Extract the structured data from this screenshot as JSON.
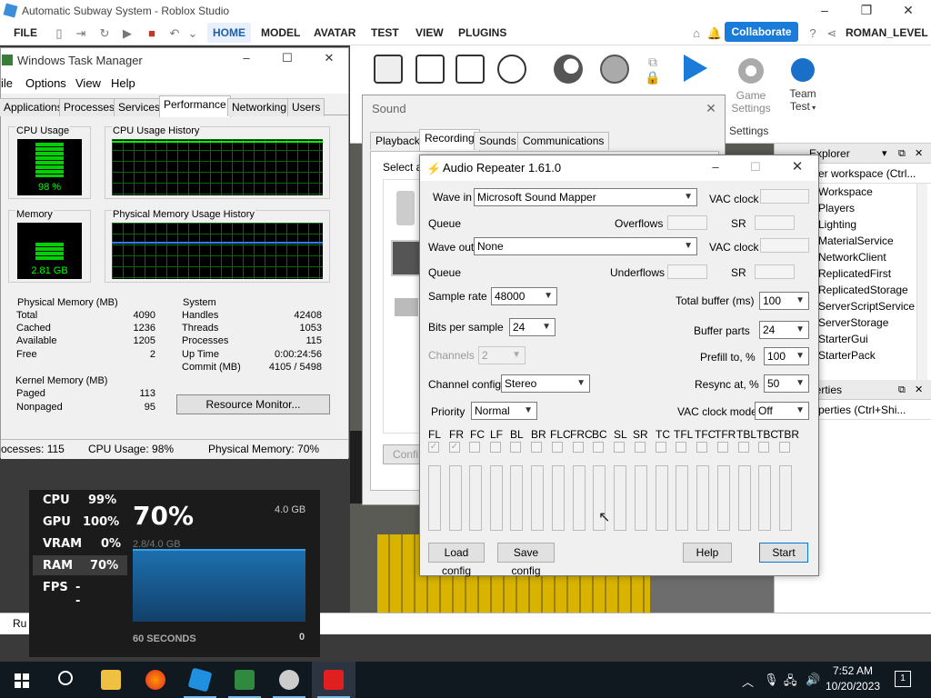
{
  "studio": {
    "title": "Automatic Subway System - Roblox Studio",
    "menu": [
      "FILE",
      "HOME",
      "MODEL",
      "AVATAR",
      "TEST",
      "VIEW",
      "PLUGINS"
    ],
    "collaborate": "Collaborate",
    "user": "ROMAN_LEVEL",
    "ribbon": {
      "game_settings_line1": "Game",
      "game_settings_line2": "Settings",
      "team_test_line1": "Team",
      "team_test_line2": "Test",
      "settings_group": "Settings"
    },
    "explorer": {
      "title": "Explorer",
      "search": "er workspace (Ctrl...",
      "items": [
        "Workspace",
        "Players",
        "Lighting",
        "MaterialService",
        "NetworkClient",
        "ReplicatedFirst",
        "ReplicatedStorage",
        "ServerScriptService",
        "ServerStorage",
        "StarterGui",
        "StarterPack"
      ]
    },
    "properties": {
      "title": "perties",
      "search": "perties (Ctrl+Shi..."
    },
    "bottom_text": "Ru"
  },
  "taskmgr": {
    "title": "Windows Task Manager",
    "menu": [
      "ile",
      "Options",
      "View",
      "Help"
    ],
    "tabs": [
      "Applications",
      "Processes",
      "Services",
      "Performance",
      "Networking",
      "Users"
    ],
    "cpu_usage_label": "CPU Usage",
    "cpu_usage_value": "98 %",
    "cpu_fraction": 0.98,
    "cpu_history_label": "CPU Usage History",
    "memory_label": "Memory",
    "memory_value": "2.81 GB",
    "memory_fraction": 0.51,
    "mem_history_label": "Physical Memory Usage History",
    "physical_memory": {
      "label": "Physical Memory (MB)",
      "rows": [
        [
          "Total",
          "4090"
        ],
        [
          "Cached",
          "1236"
        ],
        [
          "Available",
          "1205"
        ],
        [
          "Free",
          "2"
        ]
      ]
    },
    "system": {
      "label": "System",
      "rows": [
        [
          "Handles",
          "42408"
        ],
        [
          "Threads",
          "1053"
        ],
        [
          "Processes",
          "115"
        ],
        [
          "Up Time",
          "0:00:24:56"
        ],
        [
          "Commit (MB)",
          "4105 / 5498"
        ]
      ]
    },
    "kernel_memory": {
      "label": "Kernel Memory (MB)",
      "rows": [
        [
          "Paged",
          "113"
        ],
        [
          "Nonpaged",
          "95"
        ]
      ]
    },
    "resource_monitor": "Resource Monitor...",
    "status": {
      "processes": "ocesses: 115",
      "cpu": "CPU Usage: 98%",
      "memory": "Physical Memory: 70%"
    }
  },
  "sound": {
    "title": "Sound",
    "tabs": [
      "Playback",
      "Recording",
      "Sounds",
      "Communications"
    ],
    "select_text": "Select a",
    "config_button": "Confi"
  },
  "audio_repeater": {
    "title": "Audio Repeater 1.61.0",
    "wave_in_label": "Wave in",
    "wave_in_value": "Microsoft Sound Mapper",
    "vac_clock_label": "VAC clock",
    "queue_label": "Queue",
    "overflows_label": "Overflows",
    "sr_label": "SR",
    "wave_out_label": "Wave out",
    "wave_out_value": "None",
    "underflows_label": "Underflows",
    "sample_rate_label": "Sample rate",
    "sample_rate_value": "48000",
    "total_buffer_label": "Total buffer (ms)",
    "total_buffer_value": "100",
    "bits_label": "Bits per sample",
    "bits_value": "24",
    "buffer_parts_label": "Buffer parts",
    "buffer_parts_value": "24",
    "channels_label": "Channels",
    "channels_value": "2",
    "prefill_label": "Prefill to, %",
    "prefill_value": "100",
    "channel_config_label": "Channel config",
    "channel_config_value": "Stereo",
    "resync_label": "Resync at, %",
    "resync_value": "50",
    "priority_label": "Priority",
    "priority_value": "Normal",
    "vac_clock_mode_label": "VAC clock mode",
    "vac_clock_mode_value": "Off",
    "channel_names": [
      "FL",
      "FR",
      "FC",
      "LF",
      "BL",
      "BR",
      "FLC",
      "FRC",
      "BC",
      "SL",
      "SR",
      "TC",
      "TFL",
      "TFC",
      "TFR",
      "TBL",
      "TBC",
      "TBR"
    ],
    "load_config": "Load config",
    "save_config": "Save config",
    "help": "Help",
    "start": "Start"
  },
  "perf_overlay": {
    "rows": [
      [
        "CPU",
        "99%"
      ],
      [
        "GPU",
        "100%"
      ],
      [
        "VRAM",
        "0%"
      ],
      [
        "RAM",
        "70%"
      ],
      [
        "FPS",
        "--"
      ]
    ],
    "big_value": "70%",
    "total": "4.0 GB",
    "used": "2.8/4.0 GB",
    "window": "60 SECONDS",
    "min": "0",
    "ram_fraction": 0.7
  },
  "taskbar": {
    "time": "7:52 AM",
    "date": "10/20/2023",
    "notifications": "1",
    "apps": [
      "start",
      "search",
      "file-explorer",
      "firefox",
      "roblox-studio",
      "task-manager",
      "sound",
      "audio-repeater"
    ]
  },
  "colors": {
    "accent": "#1a7cd8",
    "gauge_green": "#00d000",
    "taskbar": "#101820"
  }
}
